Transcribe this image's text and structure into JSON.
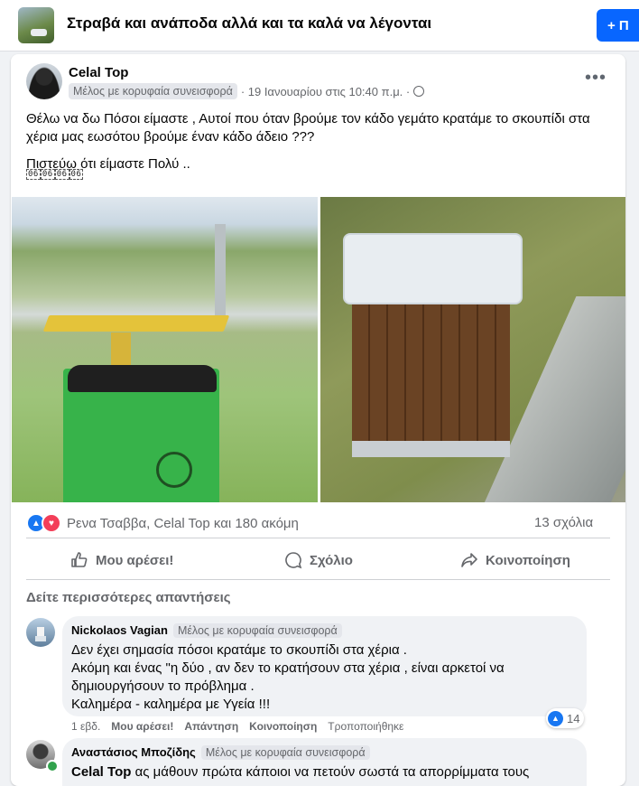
{
  "header": {
    "group_title": "Στραβά και ανάποδα αλλά και τα καλά να λέγονται",
    "join_label": "+ Π"
  },
  "post": {
    "author": "Celal Top",
    "badge": "Μέλος με κορυφαία συνεισφορά",
    "timestamp": "· 19 Ιανουαρίου στις 10:40 π.μ. ·",
    "more_label": "•••",
    "text_line1": "Θέλω να δω Πόσοι είμαστε , Αυτοί που όταν βρούμε τον κάδο γεμάτο κρατάμε το σκουπίδι στα χέρια μας εωσότου βρούμε έναν κάδο άδειο ???",
    "text_line2": "Πιστεύω ότι είμαστε Πολύ ..",
    "tags": [
      "06",
      "06",
      "06",
      "06"
    ],
    "reactions_text": "Ρενα Τσαββα, Celal Top και 180 ακόμη",
    "comments_count": "13 σχόλια",
    "actions": {
      "like": "Μου αρέσει!",
      "comment": "Σχόλιο",
      "share": "Κοινοποίηση"
    },
    "more_replies": "Δείτε περισσότερες απαντήσεις"
  },
  "comments": [
    {
      "author": "Nickolaos Vagian",
      "badge": "Μέλος με κορυφαία συνεισφορά",
      "line1": "Δεν έχει σημασία πόσοι κρατάμε το σκουπίδι στα χέρια .",
      "line2": "Ακόμη και ένας \"η δύο , αν δεν το κρατήσουν στα χέρια , είναι αρκετοί να δημιουργήσουν το πρόβλημα .",
      "line3": "Καλημέρα - καλημέρα με Υγεία !!!",
      "age": "1 εβδ.",
      "like": "Μου αρέσει!",
      "reply": "Απάντηση",
      "share": "Κοινοποίηση",
      "edited": "Τροποποιήθηκε",
      "like_count": "14"
    },
    {
      "author": "Αναστάσιος Μποζίδης",
      "badge": "Μέλος με κορυφαία συνεισφορά",
      "mention": "Celal Top",
      "text": "ας μάθουν πρώτα κάποιοι να πετούν σωστά τα απορρίμματα τους"
    }
  ]
}
